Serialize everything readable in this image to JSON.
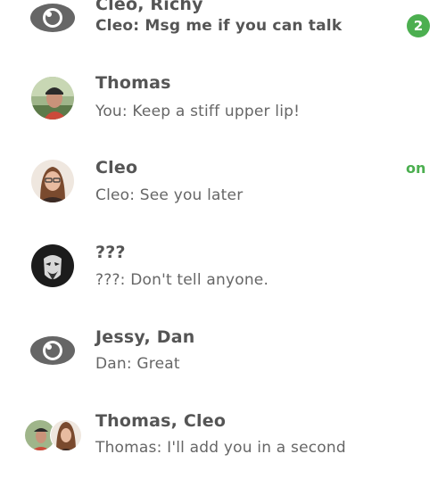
{
  "conversations": [
    {
      "title": "Cleo, Richy",
      "preview": "Cleo: Msg me if you can talk",
      "unread": "2",
      "avatar": "eye-icon"
    },
    {
      "title": "Thomas",
      "preview": "You: Keep a stiff upper lip!",
      "avatar": "thomas-photo"
    },
    {
      "title": "Cleo",
      "preview": "Cleo: See you later",
      "status": "on",
      "avatar": "cleo-photo"
    },
    {
      "title": "???",
      "preview": "???: Don't tell anyone.",
      "avatar": "mask-photo"
    },
    {
      "title": "Jessy, Dan",
      "preview": "Dan: Great",
      "avatar": "eye-icon"
    },
    {
      "title": "Thomas, Cleo",
      "preview": "Thomas: I'll add you in a second",
      "avatar": "group-photo"
    }
  ],
  "colors": {
    "accent": "#4caf50",
    "text": "#555555"
  }
}
